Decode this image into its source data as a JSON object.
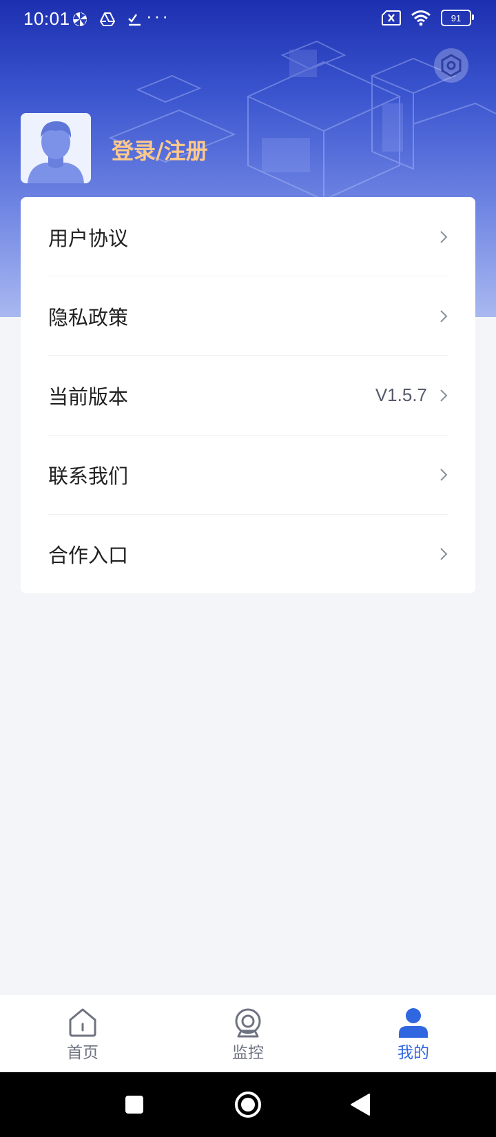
{
  "status_bar": {
    "time": "10:01",
    "battery": "91",
    "icons": [
      "pinwheel-icon",
      "drive-icon",
      "checklist-icon",
      "more-dots-icon",
      "sim-error-icon",
      "wifi-icon",
      "battery-icon"
    ]
  },
  "header": {
    "login_label": "登录/注册",
    "settings_icon": "settings-hex-icon"
  },
  "menu": [
    {
      "label": "用户协议",
      "value": ""
    },
    {
      "label": "隐私政策",
      "value": ""
    },
    {
      "label": "当前版本",
      "value": "V1.5.7"
    },
    {
      "label": "联系我们",
      "value": ""
    },
    {
      "label": "合作入口",
      "value": ""
    }
  ],
  "tabs": [
    {
      "label": "首页",
      "icon": "home-icon",
      "active": false
    },
    {
      "label": "监控",
      "icon": "camera-icon",
      "active": false
    },
    {
      "label": "我的",
      "icon": "user-icon",
      "active": true
    }
  ],
  "colors": {
    "accent": "#3067e0",
    "login_text": "#ffc98b",
    "header_top": "#1c2fb0"
  }
}
